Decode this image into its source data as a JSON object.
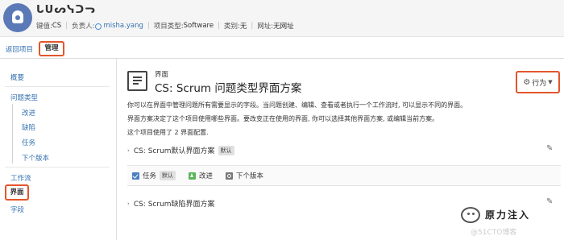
{
  "header": {
    "project_name": "ᒐᑌᔕᓭᑐᓓ",
    "key_label": "键值:",
    "key_value": "CS",
    "lead_label": "负责人:",
    "lead_value": "misha.yang",
    "type_label": "项目类型:",
    "type_value": "Software",
    "category_label": "类别:",
    "category_value": "无",
    "url_label": "网址:",
    "url_value": "无网址"
  },
  "tabs": {
    "back": "返回项目",
    "manage": "管理"
  },
  "sidebar": {
    "overview": "概要",
    "issue_types": "问题类型",
    "sub_items": [
      "改进",
      "缺陷",
      "任务",
      "下个版本"
    ],
    "workflows": "工作流",
    "screens": "界面",
    "fields": "字段"
  },
  "main": {
    "crumb": "界面",
    "title": "CS: Scrum 问题类型界面方案",
    "action_label": "行为",
    "desc1": "你可以在界面中管理问题所有需要显示的字段。当问题创建、编辑、查看或者执行一个工作流时, 可以显示不同的界面。",
    "desc2": "界面方案决定了这个项目使用哪些界面。要改变正在使用的界面, 你可以选择其他界面方案, 或编辑当前方案。",
    "desc3": "这个项目使用了 2 界面配置.",
    "scheme1": "CS: Scrum默认界面方案",
    "default_badge": "默认",
    "issue_types": [
      {
        "label": "任务",
        "badge": "默认",
        "icon": "task-icon"
      },
      {
        "label": "改进",
        "icon": "improvement-icon"
      },
      {
        "label": "下个版本",
        "icon": "version-icon"
      }
    ],
    "scheme2": "CS: Scrum缺陷界面方案"
  },
  "watermark": {
    "name": "原力注入",
    "site": "@51CTO博客"
  }
}
